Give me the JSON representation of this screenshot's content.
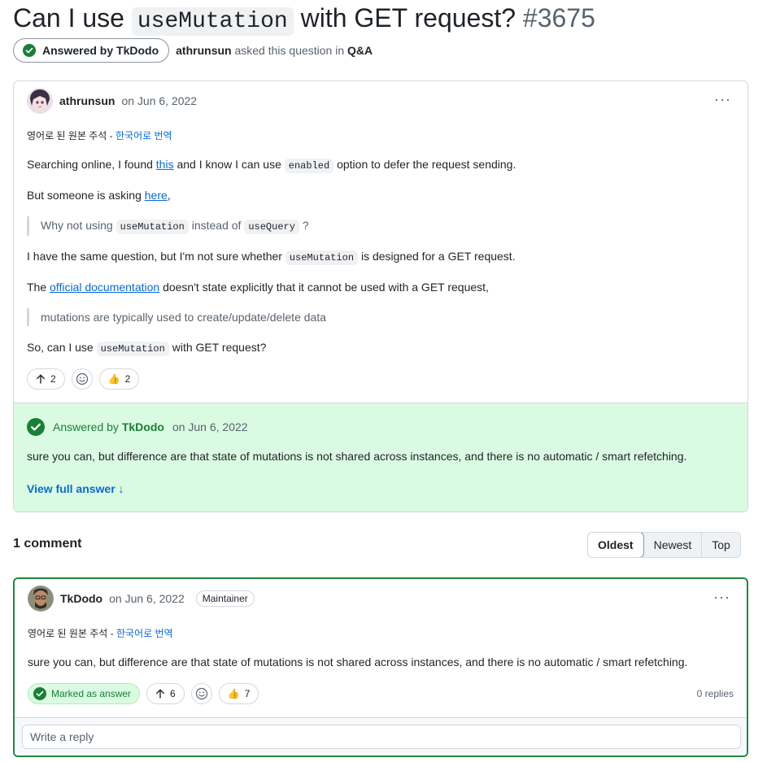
{
  "discussion": {
    "title_before": "Can I use ",
    "title_code": "useMutation",
    "title_after": " with GET request?",
    "number": "#3675",
    "answered_pill": "Answered by TkDodo",
    "asker": "athrunsun",
    "asked_text": "asked this question in",
    "category": "Q&A"
  },
  "question": {
    "author": "athrunsun",
    "date": "on Jun 6, 2022",
    "menu": "···",
    "translation_note": "영어로 된 원본 주석 - ",
    "translation_link": "한국어로 번역",
    "p1_a": "Searching online, I found ",
    "p1_link": "this",
    "p1_b": " and I know I can use ",
    "p1_code": "enabled",
    "p1_c": " option to defer the request sending.",
    "p2_a": "But someone is asking ",
    "p2_link": "here",
    "p2_b": ",",
    "q1_a": "Why not using ",
    "q1_code1": "useMutation",
    "q1_b": " instead of ",
    "q1_code2": "useQuery",
    "q1_c": " ?",
    "p3_a": "I have the same question, but I'm not sure whether ",
    "p3_code": "useMutation",
    "p3_b": " is designed for a GET request.",
    "p4_a": "The ",
    "p4_link": "official documentation",
    "p4_b": " doesn't state explicitly that it cannot be used with a GET request,",
    "q2": "mutations are typically used to create/update/delete data",
    "p5_a": "So, can I use ",
    "p5_code": "useMutation",
    "p5_b": " with GET request?",
    "upvotes": "2",
    "thumbs_count": "2",
    "thumbs_emoji": "👍"
  },
  "answer_panel": {
    "answered_by": "Answered by ",
    "answerer": "TkDodo",
    "date": "on Jun 6, 2022",
    "text": "sure you can, but difference are that state of mutations is not shared across instances, and there is no automatic / smart refetching.",
    "view_full": "View full answer ↓"
  },
  "comments": {
    "count_label": "1 comment",
    "sort": [
      "Oldest",
      "Newest",
      "Top"
    ]
  },
  "comment": {
    "author": "TkDodo",
    "date": "on Jun 6, 2022",
    "badge": "Maintainer",
    "menu": "···",
    "translation_note": "영어로 된 원본 주석 - ",
    "translation_link": "한국어로 번역",
    "text": "sure you can, but difference are that state of mutations is not shared across instances, and there is no automatic / smart refetching.",
    "marked": "Marked as answer",
    "upvotes": "6",
    "thumbs_count": "7",
    "thumbs_emoji": "👍",
    "replies": "0 replies",
    "reply_placeholder": "Write a reply"
  },
  "colors": {
    "accent": "#0969da",
    "success": "#1a7f37",
    "answer_bg": "#dafbe1"
  },
  "icons": [
    "check-circle-icon",
    "arrow-up-icon",
    "smiley-icon",
    "kebab-icon"
  ]
}
